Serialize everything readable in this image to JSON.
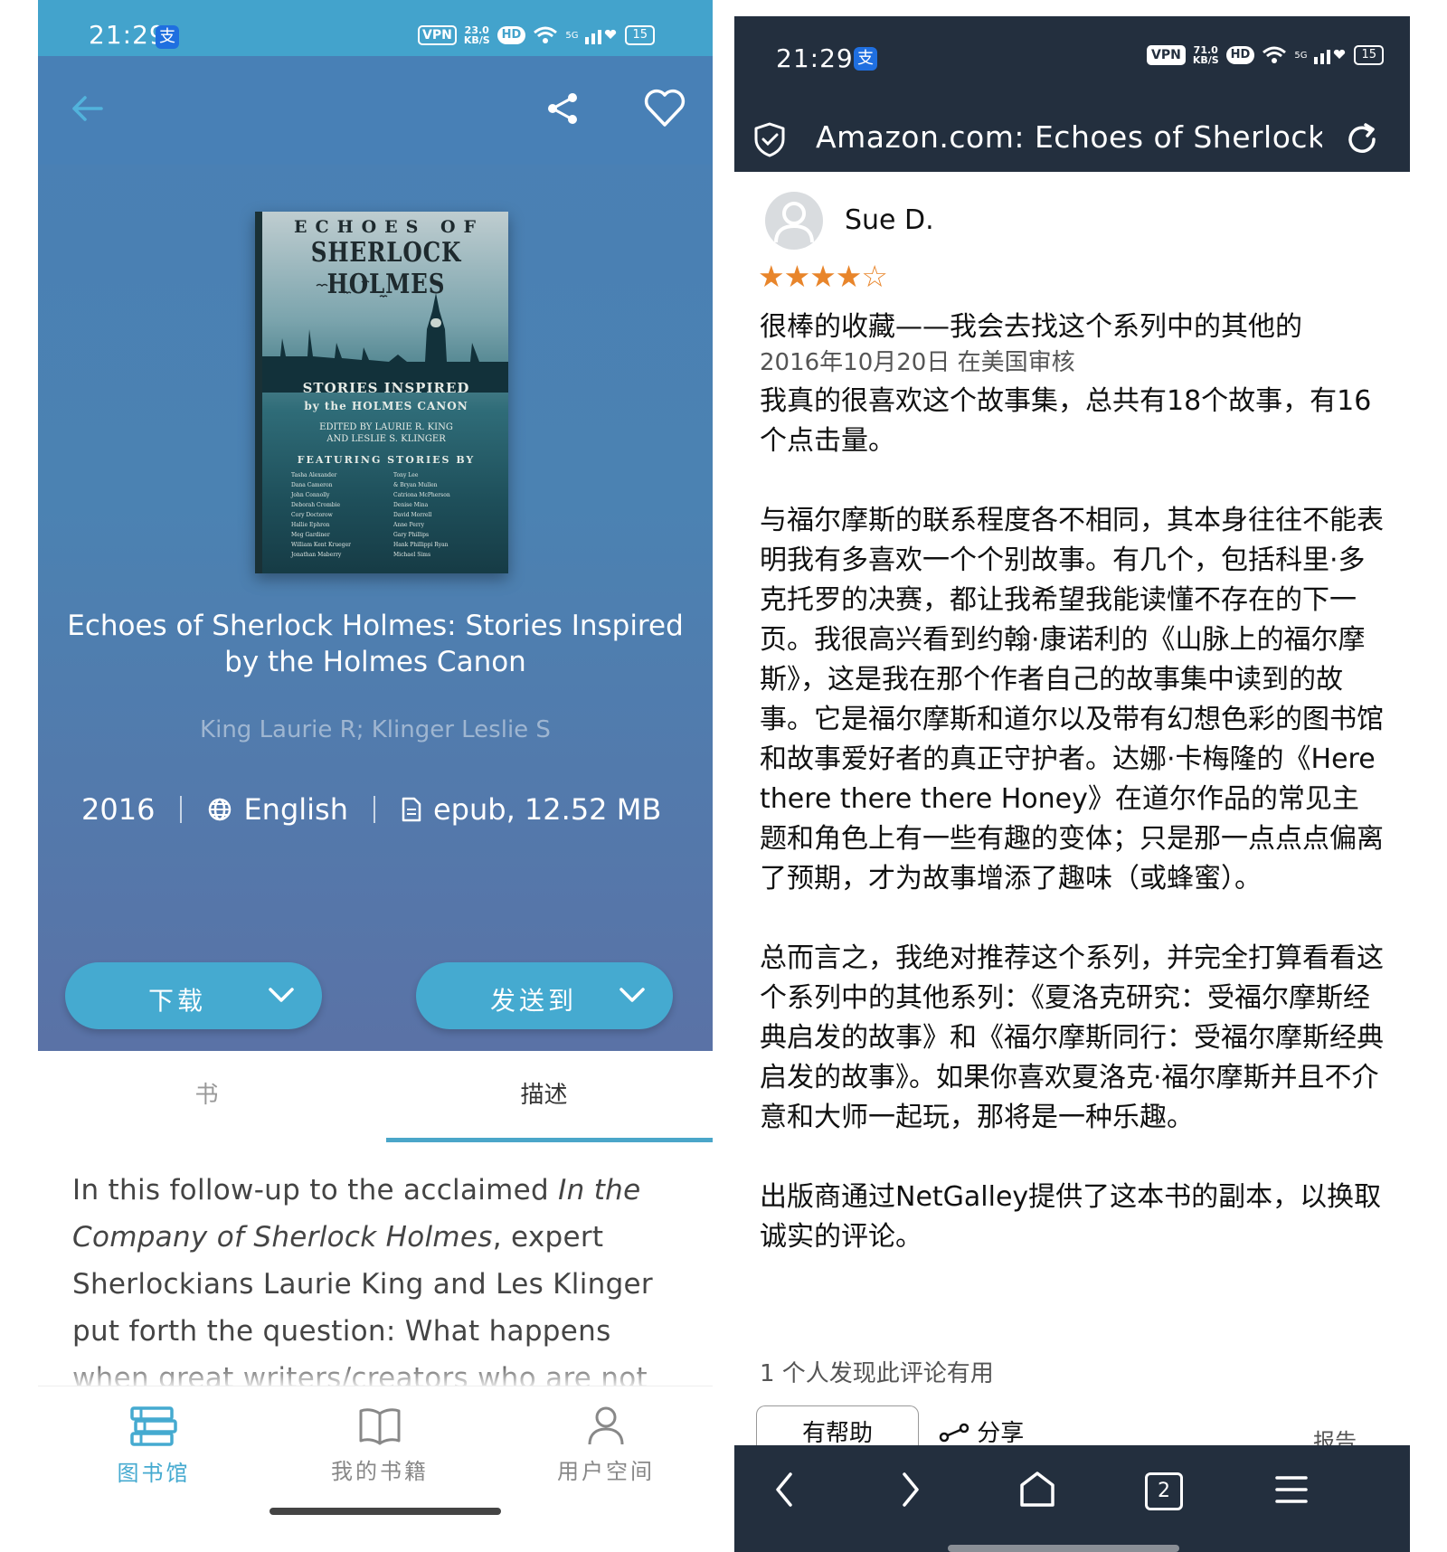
{
  "left": {
    "status": {
      "time": "21:29",
      "app_badge": "支",
      "vpn": "VPN",
      "speed": "23.0",
      "speed_unit": "KB/S",
      "hd": "HD",
      "signal": "5G",
      "battery": "15"
    },
    "cover": {
      "line1": "ECHOES OF",
      "line2": "SHERLOCK HOLMES",
      "line3": "STORIES INSPIRED",
      "line3b": "by the HOLMES CANON",
      "editors": "EDITED BY LAURIE R. KING",
      "editors2": "AND LESLIE S. KLINGER",
      "featuring": "FEATURING STORIES BY",
      "contributors": [
        "Tasha Alexander",
        "Dana Cameron",
        "John Connolly",
        "Deborah Crombie",
        "Cory Doctorow",
        "Hallie Ephron",
        "Meg Gardiner",
        "William Kent Krueger",
        "Jonathan Maberry",
        "Tony Lee",
        "& Bryan Mullen",
        "Catriona McPherson",
        "Denise Mina",
        "David Morrell",
        "Anne Perry",
        "Gary Phillips",
        "Hank Phillippi Ryan",
        "Michael Sims"
      ]
    },
    "book": {
      "title": "Echoes of Sherlock Holmes: Stories Inspired by the Holmes Canon",
      "authors": "King Laurie R; Klinger Leslie S",
      "year": "2016",
      "language": "English",
      "file": "epub, 12.52 MB"
    },
    "actions": {
      "download": "下载",
      "send_to": "发送到"
    },
    "tabs": {
      "book": "书",
      "description": "描述"
    },
    "description": {
      "p1": "In this follow-up to the acclaimed ",
      "p1_italic": "In the Company of Sherlock Holmes",
      "p2": ", expert Sherlockians Laurie King and Les Klinger put forth the question: What happens when great writers/creators who are not"
    },
    "nav": {
      "library": "图书馆",
      "my_books": "我的书籍",
      "user_space": "用户空间"
    },
    "colors": {
      "accent": "#45aad0",
      "hero": "#4a7fb4"
    }
  },
  "right": {
    "status": {
      "time": "21:29",
      "app_badge": "支",
      "vpn": "VPN",
      "speed": "71.0",
      "speed_unit": "KB/S",
      "hd": "HD",
      "signal": "5G",
      "battery": "15"
    },
    "url": "Amazon.com: Echoes of Sherlock",
    "review": {
      "reviewer": "Sue D.",
      "rating": 4,
      "rating_max": 5,
      "title": "很棒的收藏——我会去找这个系列中的其他的",
      "date": "2016年10月20日 在美国审核",
      "paragraphs": [
        "我真的很喜欢这个故事集，总共有18个故事，有16个点击量。",
        "与福尔摩斯的联系程度各不相同，其本身往往不能表明我有多喜欢一个个别故事。有几个，包括科里·多克托罗的决赛，都让我希望我能读懂不存在的下一页。我很高兴看到约翰·康诺利的《山脉上的福尔摩斯》，这是我在那个作者自己的故事集中读到的故事。它是福尔摩斯和道尔以及带有幻想色彩的图书馆和故事爱好者的真正守护者。达娜·卡梅隆的《Here there there there Honey》在道尔作品的常见主题和角色上有一些有趣的变体；只是那一点点点偏离了预期，才为故事增添了趣味（或蜂蜜）。",
        "总而言之，我绝对推荐这个系列，并完全打算看看这个系列中的其他系列：《夏洛克研究：受福尔摩斯经典启发的故事》和《福尔摩斯同行：受福尔摩斯经典启发的故事》。如果你喜欢夏洛克·福尔摩斯并且不介意和大师一起玩，那将是一种乐趣。",
        "出版商通过NetGalley提供了这本书的副本，以换取诚实的评论。"
      ],
      "helpful_count": "1 个人发现此评论有用",
      "helpful_button": "有帮助",
      "share": "分享",
      "report": "报告"
    },
    "browser": {
      "tab_count": "2"
    },
    "colors": {
      "header": "#232f3e",
      "stars": "#e8852b"
    }
  }
}
